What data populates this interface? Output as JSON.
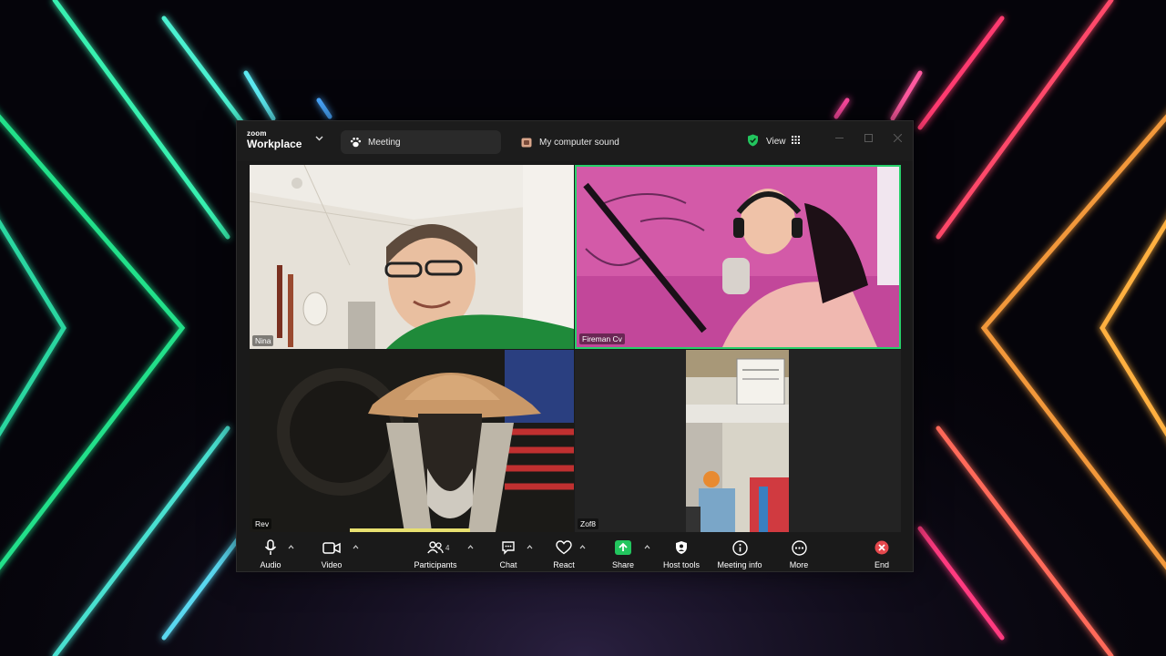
{
  "app": {
    "logo_small": "zoom",
    "logo_large": "Workplace"
  },
  "tabs": [
    {
      "label": "Meeting"
    },
    {
      "label": "My computer sound"
    }
  ],
  "view_label": "View",
  "participants": [
    {
      "name": "Nina"
    },
    {
      "name": "Fireman Cv"
    },
    {
      "name": "Rev"
    },
    {
      "name": "Zof8"
    }
  ],
  "toolbar": {
    "audio": "Audio",
    "video": "Video",
    "participants": "Participants",
    "participant_count": "4",
    "chat": "Chat",
    "react": "React",
    "share": "Share",
    "host_tools": "Host tools",
    "meeting_info": "Meeting info",
    "more": "More",
    "end": "End"
  },
  "colors": {
    "active_speaker_border": "#27d06a",
    "share_green": "#22c55e",
    "end_red": "#e5484d"
  }
}
